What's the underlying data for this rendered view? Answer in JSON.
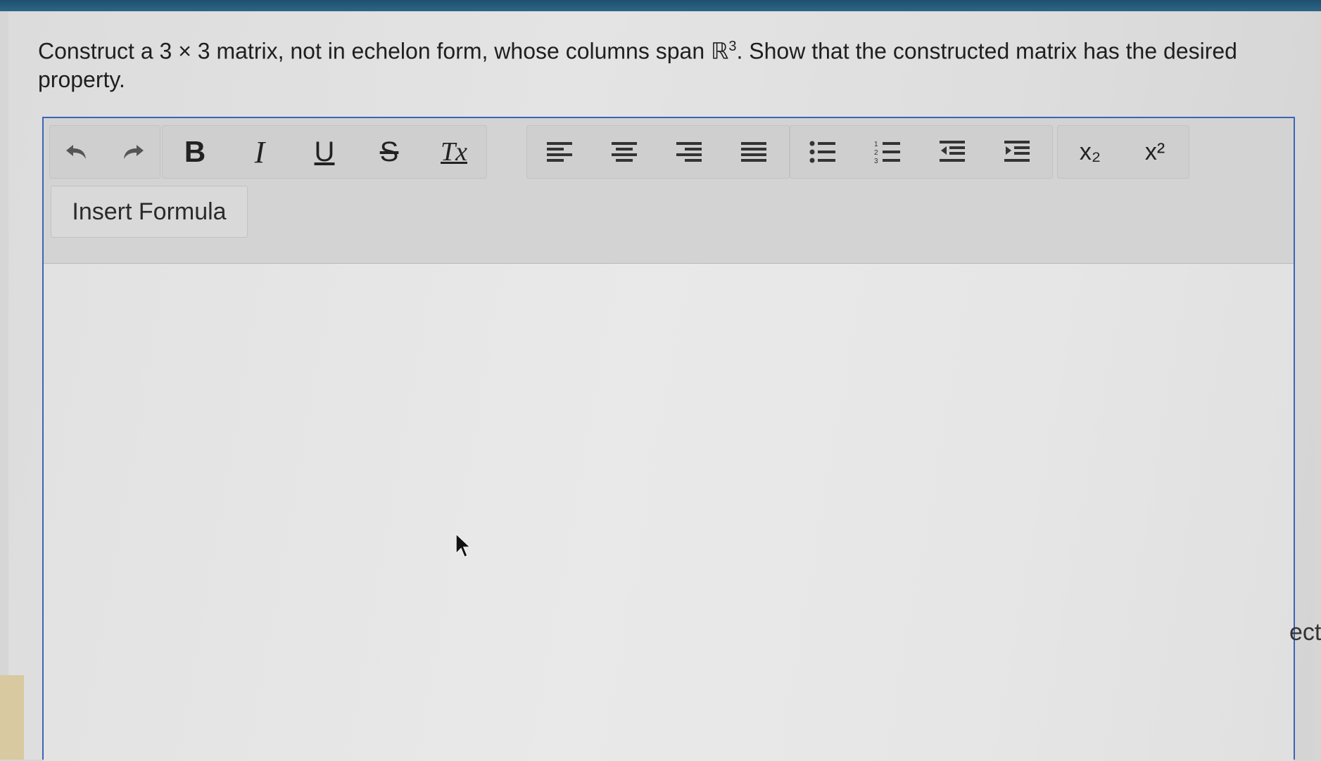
{
  "question": {
    "text_before": "Construct a 3 × 3 matrix, not in echelon form, whose columns span ℝ",
    "superscript": "3",
    "text_after": ". Show that the constructed matrix has the desired property."
  },
  "toolbar": {
    "insert_formula_label": "Insert Formula",
    "buttons": {
      "bold": "B",
      "italic": "I",
      "underline": "U",
      "strike": "S",
      "clear_format": "Tx",
      "subscript": "x₂",
      "superscript": "x²"
    }
  },
  "right_clipped_text": "ect",
  "colors": {
    "editor_border": "#3e63b5",
    "top_band": "#1e4f6e"
  }
}
